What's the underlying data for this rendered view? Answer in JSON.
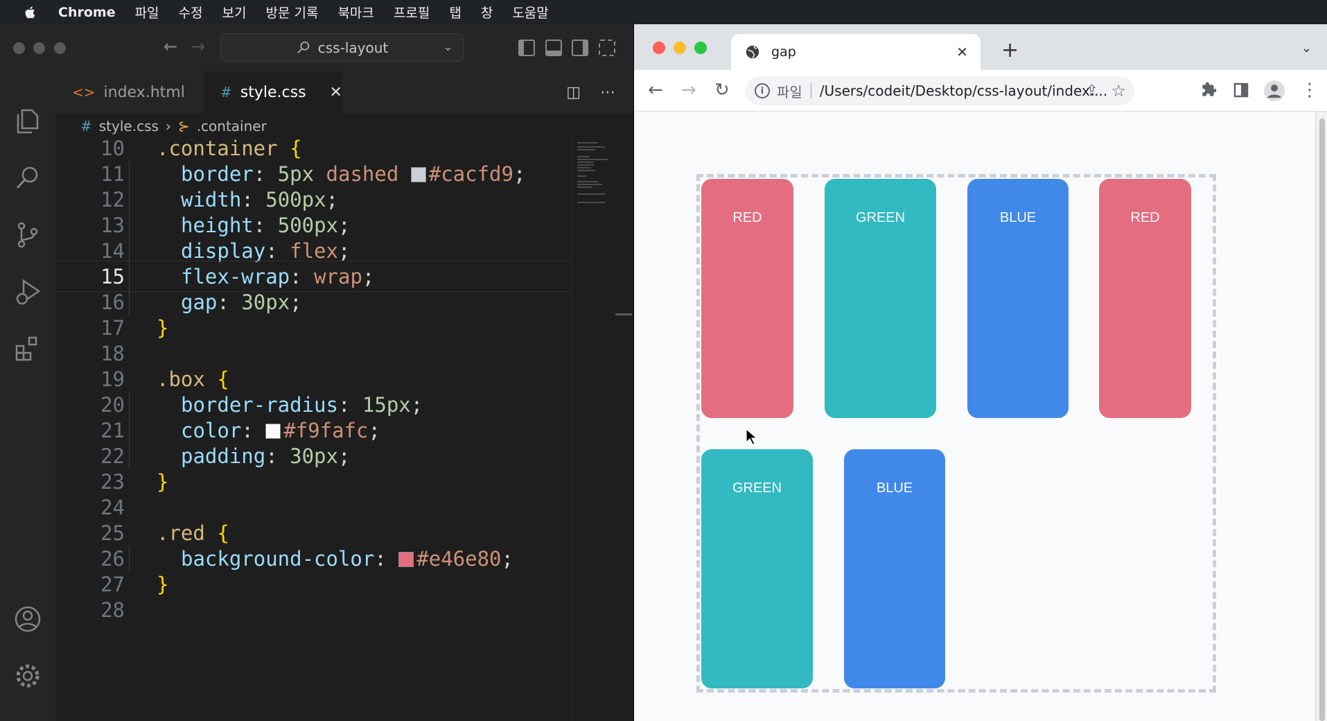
{
  "menubar": {
    "app": "Chrome",
    "items": [
      "파일",
      "수정",
      "보기",
      "방문 기록",
      "북마크",
      "프로필",
      "탭",
      "창",
      "도움말"
    ]
  },
  "vscode": {
    "search": "css-layout",
    "tabs": [
      {
        "label": "index.html",
        "icon": "html-icon"
      },
      {
        "label": "style.css",
        "icon": "css-hash-icon"
      }
    ],
    "breadcrumb": {
      "file": "style.css",
      "symbol": ".container"
    },
    "lines": [
      {
        "n": "10",
        "tokens": [
          [
            "sel",
            ".container "
          ],
          [
            "brace",
            "{"
          ]
        ]
      },
      {
        "n": "11",
        "indent": true,
        "tokens": [
          [
            "prop",
            "border"
          ],
          [
            "plain",
            ": "
          ],
          [
            "num",
            "5px "
          ],
          [
            "kw",
            "dashed "
          ],
          [
            "swatch",
            "#cacfd9"
          ],
          [
            "kw",
            "#cacfd9"
          ],
          [
            "plain",
            ";"
          ]
        ]
      },
      {
        "n": "12",
        "indent": true,
        "tokens": [
          [
            "prop",
            "width"
          ],
          [
            "plain",
            ": "
          ],
          [
            "num",
            "500px"
          ],
          [
            "plain",
            ";"
          ]
        ]
      },
      {
        "n": "13",
        "indent": true,
        "tokens": [
          [
            "prop",
            "height"
          ],
          [
            "plain",
            ": "
          ],
          [
            "num",
            "500px"
          ],
          [
            "plain",
            ";"
          ]
        ]
      },
      {
        "n": "14",
        "indent": true,
        "tokens": [
          [
            "prop",
            "display"
          ],
          [
            "plain",
            ": "
          ],
          [
            "kw",
            "flex"
          ],
          [
            "plain",
            ";"
          ]
        ]
      },
      {
        "n": "15",
        "indent": true,
        "current": true,
        "tokens": [
          [
            "prop",
            "flex-wrap"
          ],
          [
            "plain",
            ": "
          ],
          [
            "kw",
            "wrap"
          ],
          [
            "plain",
            ";"
          ]
        ]
      },
      {
        "n": "16",
        "indent": true,
        "tokens": [
          [
            "prop",
            "gap"
          ],
          [
            "plain",
            ": "
          ],
          [
            "num",
            "30px"
          ],
          [
            "plain",
            ";"
          ]
        ]
      },
      {
        "n": "17",
        "tokens": [
          [
            "brace",
            "}"
          ]
        ]
      },
      {
        "n": "18",
        "tokens": []
      },
      {
        "n": "19",
        "tokens": [
          [
            "sel",
            ".box "
          ],
          [
            "brace",
            "{"
          ]
        ]
      },
      {
        "n": "20",
        "indent": true,
        "tokens": [
          [
            "prop",
            "border-radius"
          ],
          [
            "plain",
            ": "
          ],
          [
            "num",
            "15px"
          ],
          [
            "plain",
            ";"
          ]
        ]
      },
      {
        "n": "21",
        "indent": true,
        "tokens": [
          [
            "prop",
            "color"
          ],
          [
            "plain",
            ": "
          ],
          [
            "swatch",
            "#f9fafc"
          ],
          [
            "kw",
            "#f9fafc"
          ],
          [
            "plain",
            ";"
          ]
        ]
      },
      {
        "n": "22",
        "indent": true,
        "tokens": [
          [
            "prop",
            "padding"
          ],
          [
            "plain",
            ": "
          ],
          [
            "num",
            "30px"
          ],
          [
            "plain",
            ";"
          ]
        ]
      },
      {
        "n": "23",
        "tokens": [
          [
            "brace",
            "}"
          ]
        ]
      },
      {
        "n": "24",
        "tokens": []
      },
      {
        "n": "25",
        "tokens": [
          [
            "sel",
            ".red "
          ],
          [
            "brace",
            "{"
          ]
        ]
      },
      {
        "n": "26",
        "indent": true,
        "tokens": [
          [
            "prop",
            "background-color"
          ],
          [
            "plain",
            ": "
          ],
          [
            "swatch",
            "#e46e80"
          ],
          [
            "kw",
            "#e46e80"
          ],
          [
            "plain",
            ";"
          ]
        ]
      },
      {
        "n": "27",
        "tokens": [
          [
            "brace",
            "}"
          ]
        ]
      },
      {
        "n": "28",
        "tokens": []
      }
    ]
  },
  "chrome": {
    "tab_title": "gap",
    "scheme_label": "파일",
    "url": "/Users/codeit/Desktop/css-layout/index....",
    "container_border": "#cacfd9",
    "boxes": [
      {
        "label": "RED",
        "color": "red"
      },
      {
        "label": "GREEN",
        "color": "green"
      },
      {
        "label": "BLUE",
        "color": "blue"
      },
      {
        "label": "RED",
        "color": "red"
      },
      {
        "label": "GREEN",
        "color": "green"
      },
      {
        "label": "BLUE",
        "color": "blue"
      }
    ]
  },
  "colors": {
    "red": "#e46e80",
    "green": "#32b9c1",
    "blue": "#4189e8",
    "text": "#f9fafc"
  }
}
